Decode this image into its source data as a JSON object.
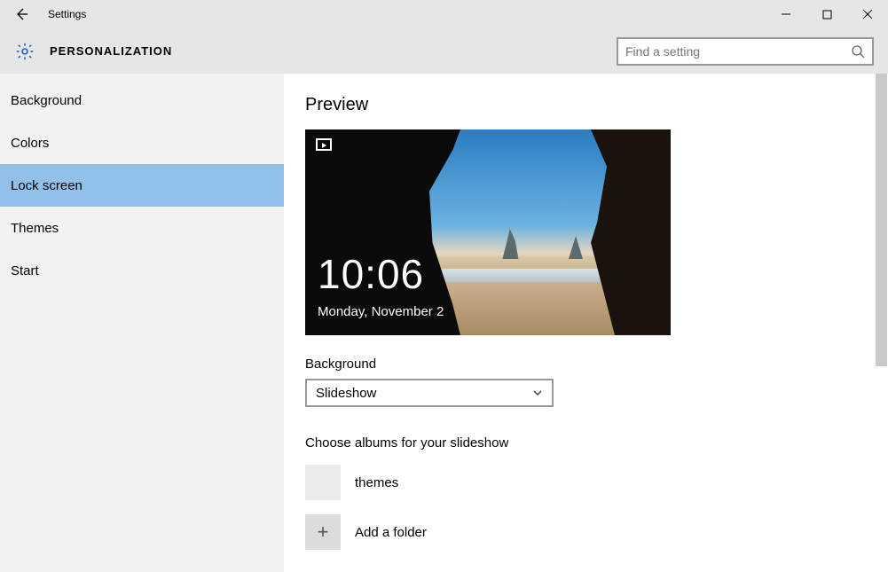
{
  "window": {
    "title": "Settings"
  },
  "header": {
    "section": "PERSONALIZATION",
    "search_placeholder": "Find a setting"
  },
  "sidebar": {
    "items": [
      {
        "label": "Background",
        "selected": false
      },
      {
        "label": "Colors",
        "selected": false
      },
      {
        "label": "Lock screen",
        "selected": true
      },
      {
        "label": "Themes",
        "selected": false
      },
      {
        "label": "Start",
        "selected": false
      }
    ]
  },
  "content": {
    "preview_heading": "Preview",
    "lock_time": "10:06",
    "lock_date": "Monday, November 2",
    "background_label": "Background",
    "background_value": "Slideshow",
    "albums_heading": "Choose albums for your slideshow",
    "albums": [
      {
        "label": "themes"
      }
    ],
    "add_folder_label": "Add a folder"
  }
}
